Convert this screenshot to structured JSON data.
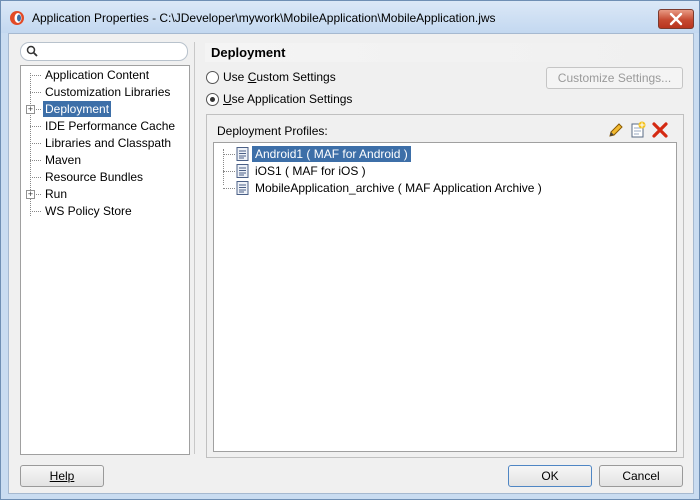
{
  "window": {
    "title": "Application Properties - C:\\JDeveloper\\mywork\\MobileApplication\\MobileApplication.jws"
  },
  "search": {
    "placeholder": ""
  },
  "tree": {
    "items": [
      {
        "label": "Application Content",
        "expandable": false,
        "selected": false
      },
      {
        "label": "Customization Libraries",
        "expandable": false,
        "selected": false
      },
      {
        "label": "Deployment",
        "expandable": true,
        "selected": true
      },
      {
        "label": "IDE Performance Cache",
        "expandable": false,
        "selected": false
      },
      {
        "label": "Libraries and Classpath",
        "expandable": false,
        "selected": false
      },
      {
        "label": "Maven",
        "expandable": false,
        "selected": false
      },
      {
        "label": "Resource Bundles",
        "expandable": false,
        "selected": false
      },
      {
        "label": "Run",
        "expandable": true,
        "selected": false
      },
      {
        "label": "WS Policy Store",
        "expandable": false,
        "selected": false
      }
    ]
  },
  "section": {
    "title": "Deployment"
  },
  "options": {
    "custom_pre": "Use ",
    "custom_u": "C",
    "custom_post": "ustom Settings",
    "custom_checked": false,
    "app_pre": "",
    "app_u": "U",
    "app_post": "se Application Settings",
    "app_checked": true,
    "customize_button": "Customize Settings..."
  },
  "profiles": {
    "label": "Deployment Profiles:",
    "items": [
      {
        "label": "Android1 ( MAF for Android )",
        "selected": true
      },
      {
        "label": "iOS1 ( MAF for iOS )",
        "selected": false
      },
      {
        "label": "MobileApplication_archive ( MAF Application Archive )",
        "selected": false
      }
    ]
  },
  "footer": {
    "help": "Help",
    "ok": "OK",
    "cancel": "Cancel"
  },
  "colors": {
    "selection": "#3d6fa8",
    "close_button": "#c64a32",
    "titlebar": "#c3d8f0"
  }
}
